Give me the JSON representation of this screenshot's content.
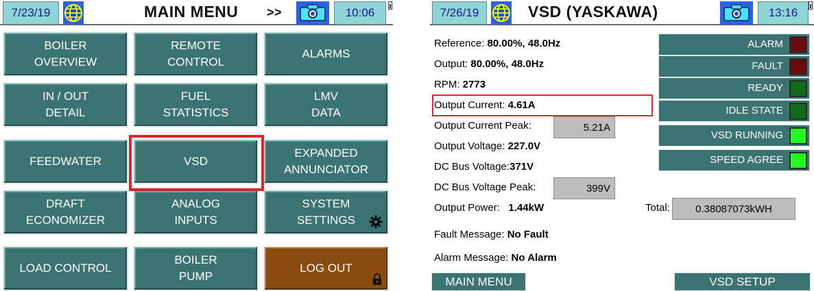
{
  "main_menu": {
    "date": "7/23/19",
    "title": "MAIN MENU",
    "next_label": ">>",
    "time": "10:06",
    "buttons": [
      {
        "label": "BOILER\nOVERVIEW"
      },
      {
        "label": "REMOTE\nCONTROL"
      },
      {
        "label": "ALARMS"
      },
      {
        "label": "IN / OUT\nDETAIL"
      },
      {
        "label": "FUEL\nSTATISTICS"
      },
      {
        "label": "LMV\nDATA"
      },
      {
        "label": "FEEDWATER"
      },
      {
        "label": "VSD"
      },
      {
        "label": "EXPANDED\nANNUNCIATOR"
      },
      {
        "label": "DRAFT\nECONOMIZER"
      },
      {
        "label": "ANALOG\nINPUTS"
      },
      {
        "label": "SYSTEM\nSETTINGS"
      },
      {
        "label": "LOAD CONTROL"
      },
      {
        "label": "BOILER\nPUMP"
      },
      {
        "label": "LOG OUT"
      }
    ]
  },
  "vsd": {
    "date": "7/26/19",
    "title": "VSD (YASKAWA)",
    "time": "13:16",
    "reference_label": "Reference:",
    "reference_value": "80.00%, 48.0Hz",
    "output_label": "Output:",
    "output_value": "80.00%, 48.0Hz",
    "rpm_label": "RPM:",
    "rpm_value": "2773",
    "output_current_label": "Output Current:",
    "output_current_value": "4.61A",
    "output_current_peak_label": "Output Current Peak:",
    "output_current_peak_value": "5.21A",
    "output_voltage_label": "Output Voltage:",
    "output_voltage_value": "227.0V",
    "dc_bus_voltage_label": "DC Bus Voltage:",
    "dc_bus_voltage_value": "371V",
    "dc_bus_voltage_peak_label": "DC Bus Voltage Peak:",
    "dc_bus_voltage_peak_value": "399V",
    "output_power_label": "Output Power:",
    "output_power_value": "1.44kW",
    "total_label": "Total:",
    "total_value": "0.38087073kWH",
    "fault_message_label": "Fault Message:",
    "fault_message_value": "No Fault",
    "alarm_message_label": "Alarm Message:",
    "alarm_message_value": "No Alarm",
    "status": [
      {
        "label": "ALARM",
        "color": "#6b0d0d"
      },
      {
        "label": "FAULT",
        "color": "#6b0d0d"
      },
      {
        "label": "READY",
        "color": "#0f6a1a"
      },
      {
        "label": "IDLE STATE",
        "color": "#0f6a1a"
      },
      {
        "label": "VSD RUNNING",
        "color": "#22ff22"
      },
      {
        "label": "SPEED AGREE",
        "color": "#22ff22"
      }
    ],
    "main_menu_button": "MAIN MENU",
    "vsd_setup_button": "VSD SETUP"
  }
}
